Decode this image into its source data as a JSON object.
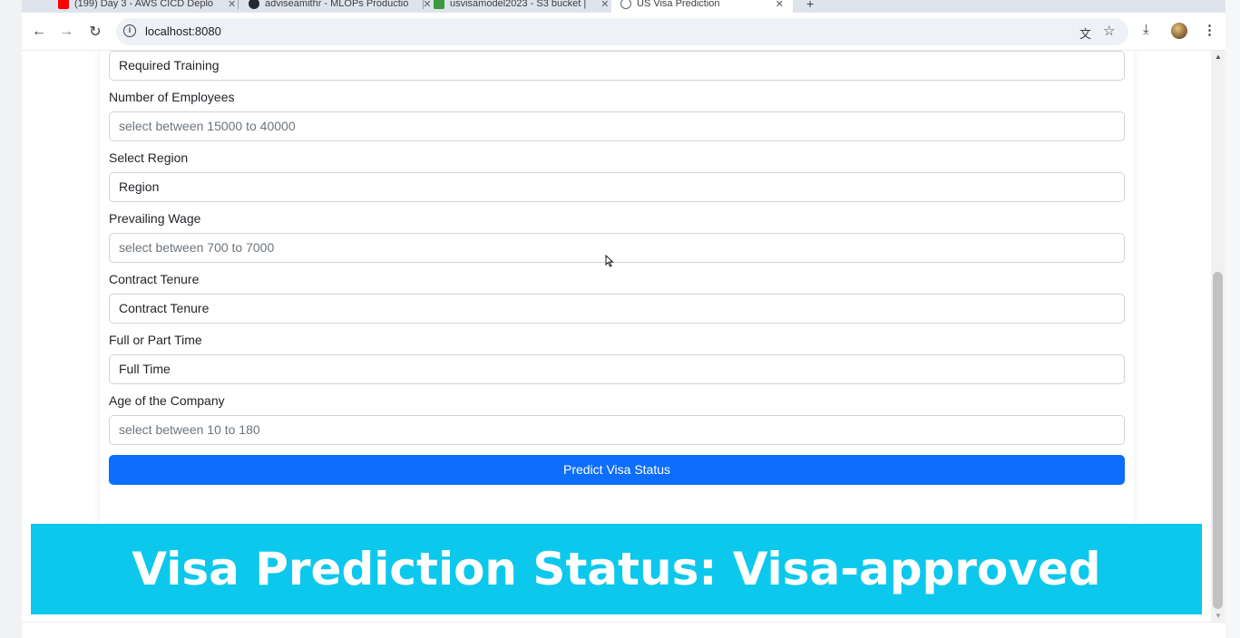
{
  "browser": {
    "tabs": [
      {
        "label": "(199) Day 3 - AWS CICD Deplo"
      },
      {
        "label": "adviseamithr - MLOPs Productio"
      },
      {
        "label": "usvisamodel2023 - S3 bucket |"
      },
      {
        "label": "US Visa Prediction"
      }
    ],
    "url": "localhost:8080"
  },
  "form": {
    "fields": [
      {
        "label": "",
        "value": "Required Training",
        "placeholder": ""
      },
      {
        "label": "Number of Employees",
        "value": "",
        "placeholder": "select between 15000 to 40000"
      },
      {
        "label": "Select Region",
        "value": "Region",
        "placeholder": ""
      },
      {
        "label": "Prevailing Wage",
        "value": "",
        "placeholder": "select between 700 to 7000"
      },
      {
        "label": "Contract Tenure",
        "value": "Contract Tenure",
        "placeholder": ""
      },
      {
        "label": "Full or Part Time",
        "value": "Full Time",
        "placeholder": ""
      },
      {
        "label": "Age of the Company",
        "value": "",
        "placeholder": "select between 10 to 180"
      }
    ],
    "submit_label": "Predict Visa Status"
  },
  "result": {
    "text": "Visa Prediction Status: Visa-approved"
  },
  "colors": {
    "primary_button": "#0d6efd",
    "banner": "#0cc8ec"
  }
}
